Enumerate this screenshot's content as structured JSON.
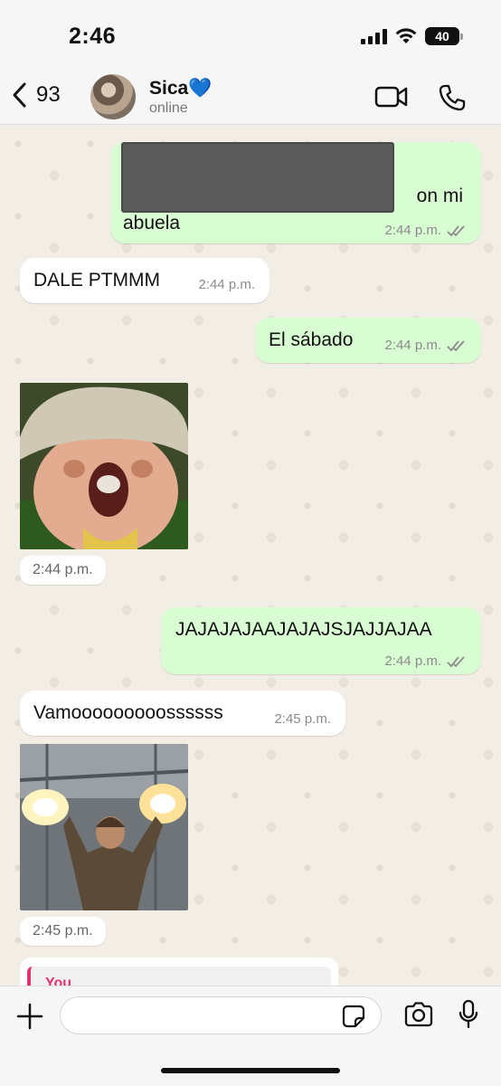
{
  "status_bar": {
    "time": "2:46",
    "battery": "40"
  },
  "header": {
    "back_count": "93",
    "contact_name": "Sica",
    "name_emoji": "💙",
    "contact_status": "online"
  },
  "messages": [
    {
      "direction": "out",
      "text_visible": "on mi",
      "text_line2": "abuela",
      "time": "2:44 p.m.",
      "redacted": true
    },
    {
      "direction": "in",
      "text": "DALE PTMMM",
      "time": "2:44 p.m."
    },
    {
      "direction": "out",
      "text": "El sábado",
      "time": "2:44 p.m."
    },
    {
      "direction": "in",
      "type": "image",
      "image_icon": "sticker-toad-screaming",
      "time": "2:44 p.m."
    },
    {
      "direction": "out",
      "text": "JAJAJAJAAJAJAJSJAJJAJAA",
      "time": "2:44 p.m."
    },
    {
      "direction": "in",
      "text": "Vamooooooooossssss",
      "time": "2:45 p.m."
    },
    {
      "direction": "in",
      "type": "image",
      "image_icon": "gif-man-firing-guns",
      "time": "2:45 p.m."
    },
    {
      "direction": "in",
      "type": "reply-preview",
      "author": "You"
    }
  ],
  "composer": {
    "placeholder": ""
  },
  "colors": {
    "outgoing_bubble": "#d9fdd3",
    "incoming_bubble": "#ffffff",
    "read_ticks": "#8a8a8a",
    "reply_accent": "#e2336b"
  },
  "icons": [
    "back-chevron-icon",
    "video-call-icon",
    "phone-icon",
    "plus-icon",
    "sticker-icon",
    "camera-icon",
    "microphone-icon",
    "double-check-icon"
  ]
}
